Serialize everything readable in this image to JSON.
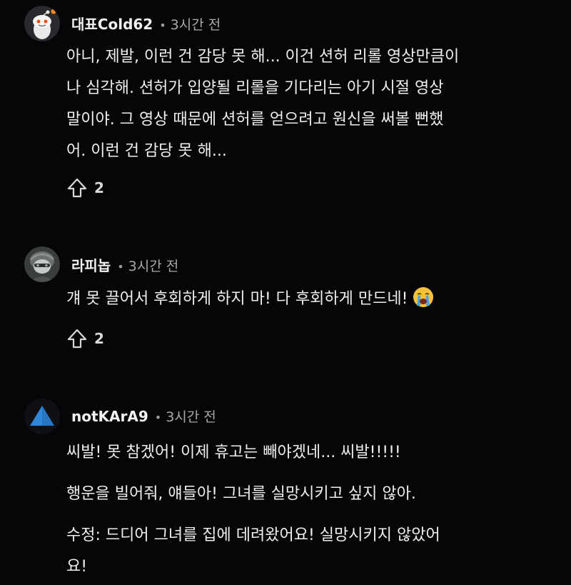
{
  "comments": [
    {
      "author": "대표Cold62",
      "time": "3시간 전",
      "lines": [
        "아니, 제발, 이런 건 감당 못 해... 이건 션허 리롤 영상만큼이",
        "나 심각해. 션허가 입양될 리롤을 기다리는 아기 시절 영상",
        "말이야. 그 영상 때문에 션허를 얻으려고 원신을 써볼 뻔했",
        "어. 이런 건 감당 못 해..."
      ],
      "votes": "2",
      "avatar_icon": "snoo-avatar-icon"
    },
    {
      "author": "라피놉",
      "time": "3시간 전",
      "text": "걔 못 끌어서 후회하게 하지 마! 다 후회하게 만드네!",
      "emoji": "loudly-crying-face-icon",
      "votes": "2",
      "avatar_icon": "character-avatar-icon"
    },
    {
      "author": "notKArA9",
      "time": "3시간 전",
      "paragraphs": [
        "씨발! 못 참겠어! 이제 휴고는 빼야겠네... 씨발!!!!!",
        "행운을 빌어줘, 얘들아! 그녀를 실망시키고 싶지 않아.",
        "수정: 드디어 그녀를 집에 데려왔어요! 실망시키지 않았어",
        "요!"
      ],
      "avatar_icon": "blue-triangle-avatar-icon"
    }
  ],
  "colors": {
    "background": "#060608",
    "text": "#efefef",
    "muted": "#a9a9a9",
    "accent_triangle": "#2f86d6",
    "emoji_yellow": "#f5c33b",
    "emoji_tears": "#4aa3df"
  }
}
